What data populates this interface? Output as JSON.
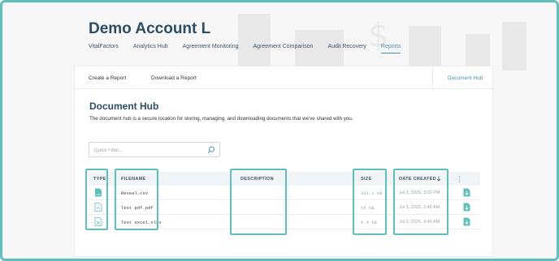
{
  "account": {
    "title": "Demo Account L"
  },
  "nav": {
    "items": [
      {
        "label": "VitalFactors"
      },
      {
        "label": "Analytics Hub"
      },
      {
        "label": "Agreement Monitoring"
      },
      {
        "label": "Agreement Comparison"
      },
      {
        "label": "Audit Recovery"
      },
      {
        "label": "Reports"
      }
    ],
    "active": "Reports"
  },
  "subnav": {
    "create": "Create a Report",
    "download": "Download a Report",
    "hub": "Document Hub"
  },
  "page": {
    "title": "Document Hub",
    "description": "The document hub is a secure location for storing, managing, and downloading documents that we've shared with you."
  },
  "search": {
    "placeholder": "Quick Filter..."
  },
  "table": {
    "headers": {
      "type": "TYPE",
      "filename": "FILENAME",
      "description": "DESCRIPTION",
      "size": "SIZE",
      "date": "DATE CREATED"
    },
    "rows": [
      {
        "type": "csv-file-icon",
        "filename": "Reveal.csv",
        "description": "",
        "size": "331.1 kB",
        "date": "Jul 3, 2025, 3:02 PM"
      },
      {
        "type": "pdf-file-icon",
        "filename": "Test pdf.pdf",
        "description": "",
        "size": "16 kB",
        "date": "Jul 3, 2025, 3:46 AM"
      },
      {
        "type": "xlsx-file-icon",
        "filename": "Test excel.xlsx",
        "description": "",
        "size": "6.4 kB",
        "date": "Jul 3, 2025, 3:46 AM"
      }
    ]
  },
  "colors": {
    "accent": "#5fbfbd",
    "primary": "#2c4d63",
    "link": "#4a8fb5"
  }
}
